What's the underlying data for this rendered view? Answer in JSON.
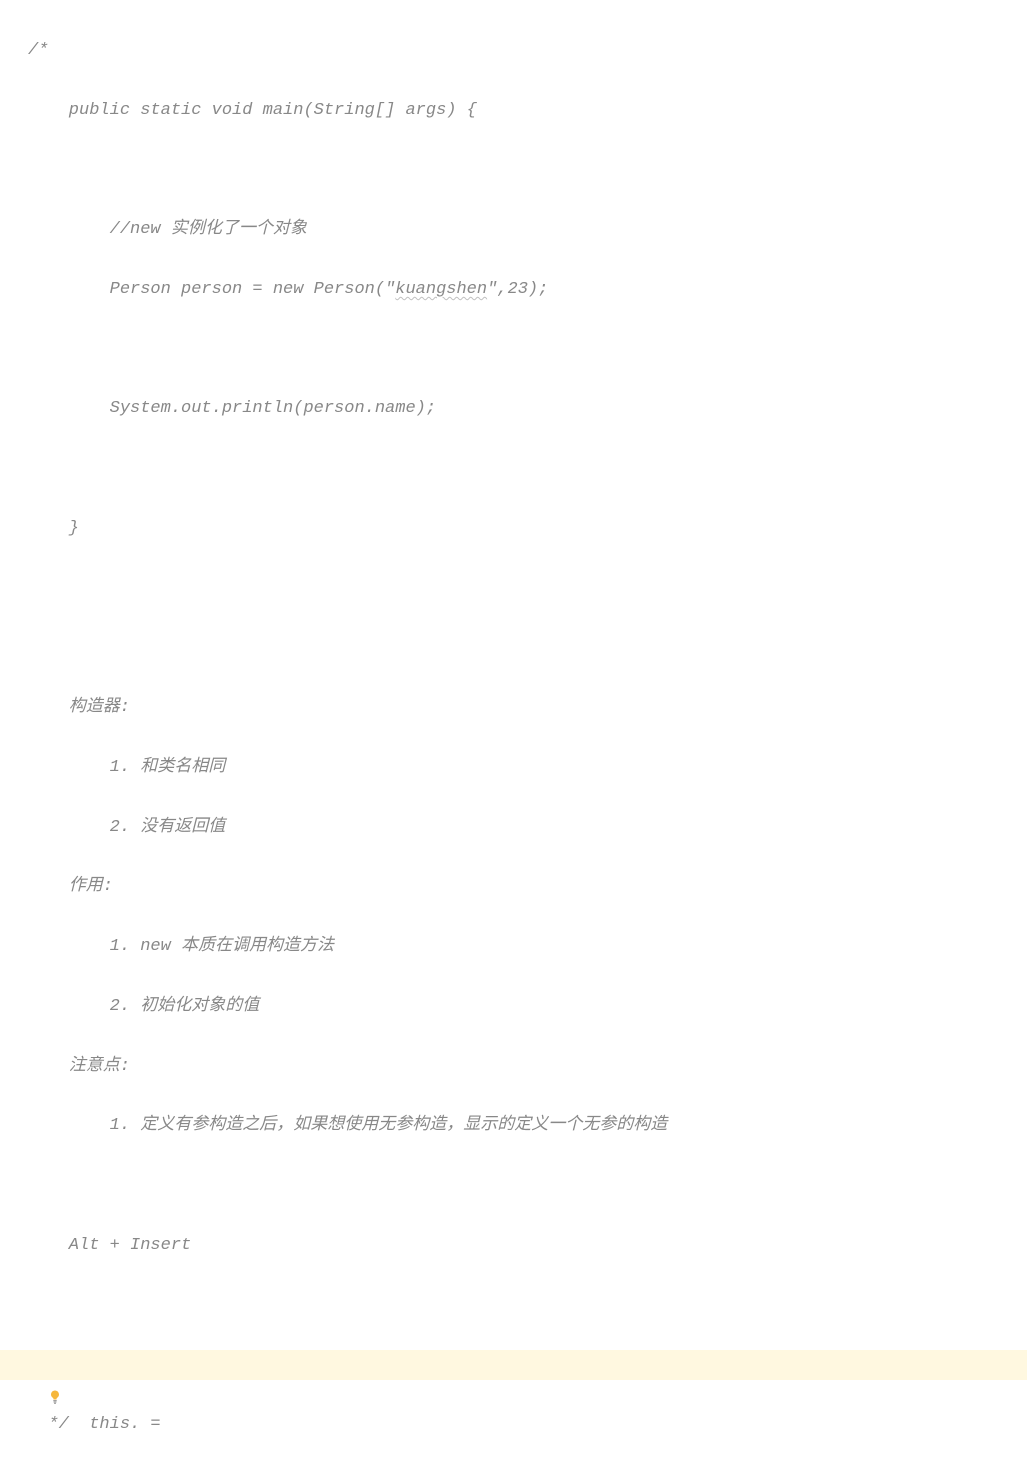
{
  "colors": {
    "comment": "#888888",
    "highlight_bg": "#fff8e0",
    "bulb": "#f6b73c"
  },
  "code": {
    "l0": "/*",
    "l1": "    public static void main(String[] args) {",
    "l2": "",
    "l3_prefix": "        //new 实例化了一个对象",
    "l4_prefix": "        Person person = new Person(\"",
    "l4_typo": "kuangshen",
    "l4_suffix": "\",23);",
    "l5": "",
    "l6": "        System.out.println(person.name);",
    "l7": "",
    "l8": "    }",
    "l9": "",
    "l10": "",
    "l11": "    构造器:",
    "l12": "        1. 和类名相同",
    "l13": "        2. 没有返回值",
    "l14": "    作用:",
    "l15": "        1. new 本质在调用构造方法",
    "l16": "        2. 初始化对象的值",
    "l17": "    注意点:",
    "l18": "        1. 定义有参构造之后，如果想使用无参构造，显示的定义一个无参的构造",
    "l19": "",
    "l20": "    Alt + Insert",
    "l21": "",
    "l22": "    this. =",
    "l23": "  */"
  }
}
